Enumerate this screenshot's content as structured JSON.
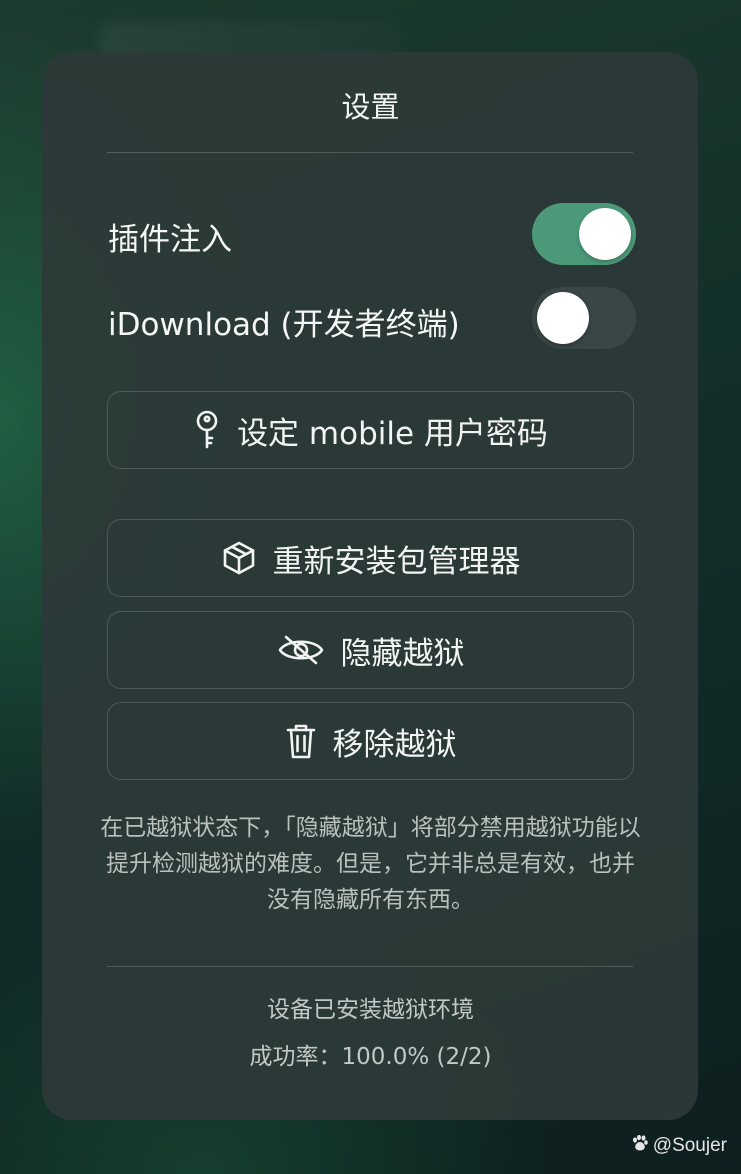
{
  "dialog": {
    "title": "设置"
  },
  "toggles": [
    {
      "label": "插件注入",
      "on": true
    },
    {
      "label": "iDownload (开发者终端)",
      "on": false
    }
  ],
  "buttons": {
    "set_password": {
      "label": "设定 mobile 用户密码",
      "icon": "key-icon"
    },
    "reinstall_pm": {
      "label": "重新安装包管理器",
      "icon": "cube-icon"
    },
    "hide_jailbreak": {
      "label": "隐藏越狱",
      "icon": "eye-slash-icon"
    },
    "remove_jailbreak": {
      "label": "移除越狱",
      "icon": "trash-icon"
    }
  },
  "note": "在已越狱状态下，「隐藏越狱」将部分禁用越狱功能以提升检测越狱的难度。但是，它并非总是有效，也并没有隐藏所有东西。",
  "status": {
    "environment": "设备已安装越狱环境",
    "success_rate": "成功率：100.0% (2/2)"
  },
  "watermark": "@Soujer",
  "colors": {
    "switch_on": "#4c9a7a",
    "panel": "#2c3a38"
  }
}
